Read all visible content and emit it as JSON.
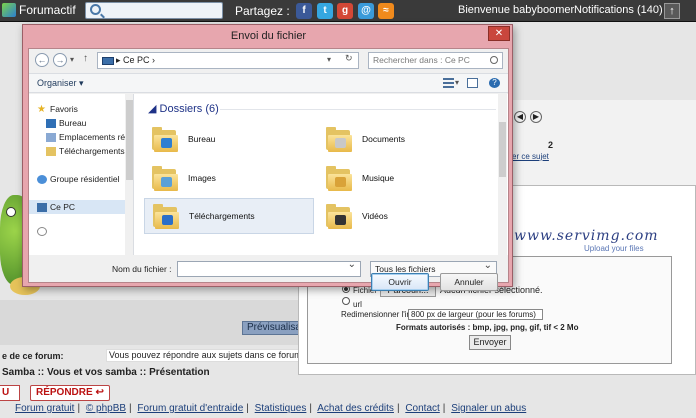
{
  "topbar": {
    "brand": "Forumactif",
    "share_label": "Partagez :",
    "welcome": "Bienvenue babyboomer",
    "notifications": "Notifications (140)"
  },
  "forum": {
    "preview_button": "Prévisualisat",
    "permission_label": "e de ce forum:",
    "permission_text": "Vous pouvez répondre aux sujets dans ce forum",
    "breadcrumb": "Samba :: Vous et vos samba :: Présentation",
    "reply_button": "RÉPONDRE",
    "prev_button": "U",
    "footer_links": [
      "Forum gratuit",
      "© phpBB",
      "Forum gratuit d'entraide",
      "Statistiques",
      "Achat des crédits",
      "Contact",
      "Signaler un abus"
    ],
    "page_number": "2",
    "link_sujet": "er ce sujet"
  },
  "servimg": {
    "logo": "www.servimg.com",
    "tagline": "Upload your files",
    "option_file": "Fichier",
    "browse_button": "Parcouri...",
    "no_file": "Aucun fichier sélectionné.",
    "option_url": "url",
    "resize_label": "Redimensionner l'image",
    "resize_value": "800 px de largeur (pour les forums)",
    "formats": "Formats autorisés : bmp, jpg, png, gif, tif < 2 Mo",
    "send_button": "Envoyer"
  },
  "dialog": {
    "title": "Envoi du fichier",
    "address": "Ce PC",
    "search_placeholder": "Rechercher dans : Ce PC",
    "organize": "Organiser",
    "nav_items": [
      {
        "label": "Favoris"
      },
      {
        "label": "Bureau"
      },
      {
        "label": "Emplacements ré"
      },
      {
        "label": "Téléchargements"
      },
      {
        "label": "Groupe résidentiel"
      },
      {
        "label": "Ce PC"
      }
    ],
    "group_header": "Dossiers (6)",
    "folders": [
      {
        "label": "Bureau",
        "badge_color": "#2f7fd1"
      },
      {
        "label": "Documents",
        "badge_color": "#c8c8c8"
      },
      {
        "label": "Images",
        "badge_color": "#5aa0d8"
      },
      {
        "label": "Musique",
        "badge_color": "#d9a238"
      },
      {
        "label": "Téléchargements",
        "badge_color": "#2a6fc9"
      },
      {
        "label": "Vidéos",
        "badge_color": "#333333"
      }
    ],
    "filename_label": "Nom du fichier :",
    "filename_value": "",
    "filter": "Tous les fichiers",
    "open_button": "Ouvrir",
    "cancel_button": "Annuler"
  }
}
